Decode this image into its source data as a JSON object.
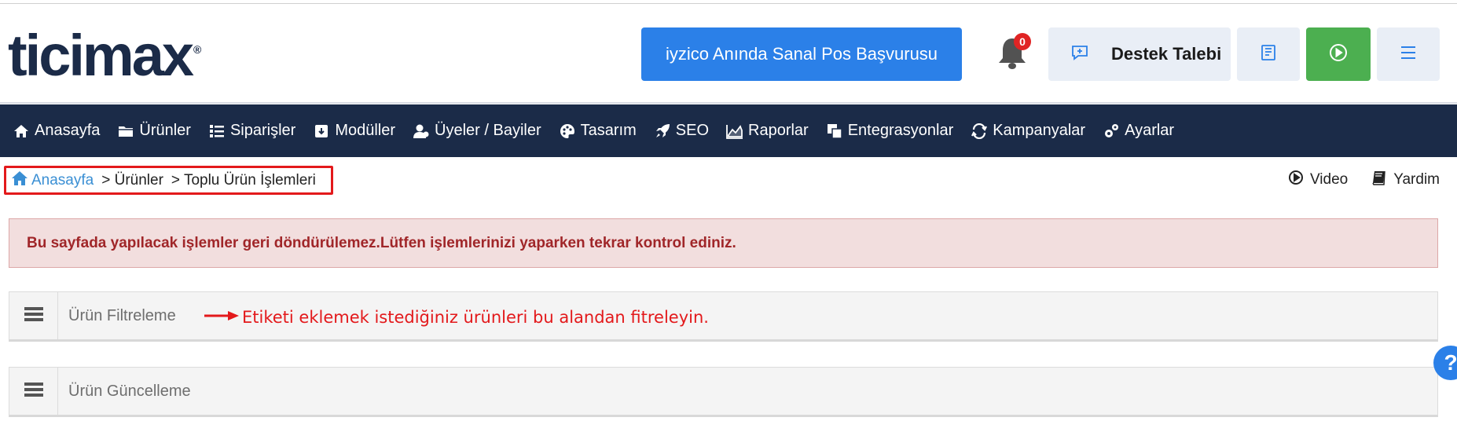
{
  "brand": {
    "logo_text": "ticimax",
    "logo_mark": "®"
  },
  "header": {
    "iyzico_label": "iyzico Anında Sanal Pos Başvurusu",
    "notification_count": "0",
    "support_label": "Destek Talebi"
  },
  "nav": {
    "items": [
      {
        "label": "Anasayfa",
        "icon": "home-icon"
      },
      {
        "label": "Ürünler",
        "icon": "folder-icon"
      },
      {
        "label": "Siparişler",
        "icon": "list-icon"
      },
      {
        "label": "Modüller",
        "icon": "download-box-icon"
      },
      {
        "label": "Üyeler / Bayiler",
        "icon": "users-icon"
      },
      {
        "label": "Tasarım",
        "icon": "palette-icon"
      },
      {
        "label": "SEO",
        "icon": "rocket-icon"
      },
      {
        "label": "Raporlar",
        "icon": "chart-icon"
      },
      {
        "label": "Entegrasyonlar",
        "icon": "windows-icon"
      },
      {
        "label": "Kampanyalar",
        "icon": "refresh-icon"
      },
      {
        "label": "Ayarlar",
        "icon": "gears-icon"
      }
    ]
  },
  "breadcrumb": {
    "home": "Anasayfa",
    "level1": "> Ürünler",
    "level2": "> Toplu Ürün İşlemleri"
  },
  "help": {
    "video": "Video",
    "help": "Yardim"
  },
  "alert": {
    "text": "Bu sayfada yapılacak işlemler geri döndürülemez.Lütfen işlemlerinizi yaparken tekrar kontrol ediniz."
  },
  "panels": {
    "filter_title": "Ürün Filtreleme",
    "update_title": "Ürün Güncelleme"
  },
  "annotation": {
    "text": "Etiketi eklemek istediğiniz ürünleri bu alandan fitreleyin."
  },
  "float_help": "?",
  "colors": {
    "nav_bg": "#1b2b48",
    "primary": "#2b80e8",
    "success": "#4caf50",
    "danger": "#e3191b",
    "alert_bg": "#f2dede"
  }
}
